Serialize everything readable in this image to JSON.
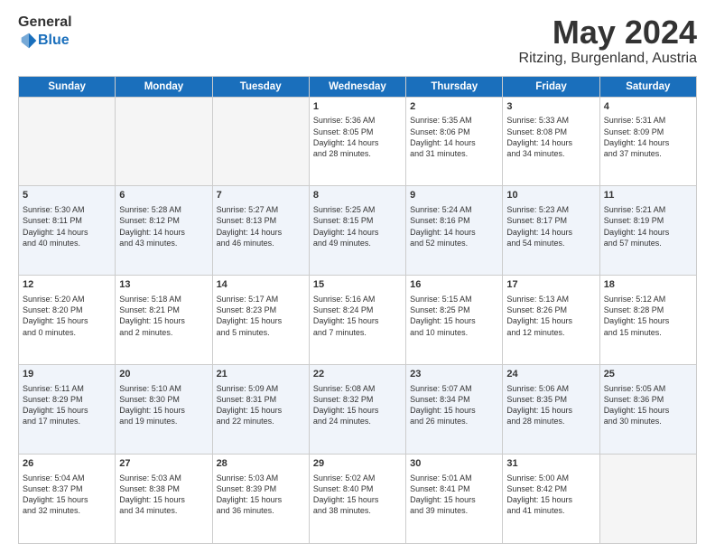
{
  "header": {
    "logo": {
      "general": "General",
      "blue": "Blue"
    },
    "title": "May 2024",
    "location": "Ritzing, Burgenland, Austria"
  },
  "days_of_week": [
    "Sunday",
    "Monday",
    "Tuesday",
    "Wednesday",
    "Thursday",
    "Friday",
    "Saturday"
  ],
  "weeks": [
    [
      {
        "day": "",
        "content": ""
      },
      {
        "day": "",
        "content": ""
      },
      {
        "day": "",
        "content": ""
      },
      {
        "day": "1",
        "content": "Sunrise: 5:36 AM\nSunset: 8:05 PM\nDaylight: 14 hours\nand 28 minutes."
      },
      {
        "day": "2",
        "content": "Sunrise: 5:35 AM\nSunset: 8:06 PM\nDaylight: 14 hours\nand 31 minutes."
      },
      {
        "day": "3",
        "content": "Sunrise: 5:33 AM\nSunset: 8:08 PM\nDaylight: 14 hours\nand 34 minutes."
      },
      {
        "day": "4",
        "content": "Sunrise: 5:31 AM\nSunset: 8:09 PM\nDaylight: 14 hours\nand 37 minutes."
      }
    ],
    [
      {
        "day": "5",
        "content": "Sunrise: 5:30 AM\nSunset: 8:11 PM\nDaylight: 14 hours\nand 40 minutes."
      },
      {
        "day": "6",
        "content": "Sunrise: 5:28 AM\nSunset: 8:12 PM\nDaylight: 14 hours\nand 43 minutes."
      },
      {
        "day": "7",
        "content": "Sunrise: 5:27 AM\nSunset: 8:13 PM\nDaylight: 14 hours\nand 46 minutes."
      },
      {
        "day": "8",
        "content": "Sunrise: 5:25 AM\nSunset: 8:15 PM\nDaylight: 14 hours\nand 49 minutes."
      },
      {
        "day": "9",
        "content": "Sunrise: 5:24 AM\nSunset: 8:16 PM\nDaylight: 14 hours\nand 52 minutes."
      },
      {
        "day": "10",
        "content": "Sunrise: 5:23 AM\nSunset: 8:17 PM\nDaylight: 14 hours\nand 54 minutes."
      },
      {
        "day": "11",
        "content": "Sunrise: 5:21 AM\nSunset: 8:19 PM\nDaylight: 14 hours\nand 57 minutes."
      }
    ],
    [
      {
        "day": "12",
        "content": "Sunrise: 5:20 AM\nSunset: 8:20 PM\nDaylight: 15 hours\nand 0 minutes."
      },
      {
        "day": "13",
        "content": "Sunrise: 5:18 AM\nSunset: 8:21 PM\nDaylight: 15 hours\nand 2 minutes."
      },
      {
        "day": "14",
        "content": "Sunrise: 5:17 AM\nSunset: 8:23 PM\nDaylight: 15 hours\nand 5 minutes."
      },
      {
        "day": "15",
        "content": "Sunrise: 5:16 AM\nSunset: 8:24 PM\nDaylight: 15 hours\nand 7 minutes."
      },
      {
        "day": "16",
        "content": "Sunrise: 5:15 AM\nSunset: 8:25 PM\nDaylight: 15 hours\nand 10 minutes."
      },
      {
        "day": "17",
        "content": "Sunrise: 5:13 AM\nSunset: 8:26 PM\nDaylight: 15 hours\nand 12 minutes."
      },
      {
        "day": "18",
        "content": "Sunrise: 5:12 AM\nSunset: 8:28 PM\nDaylight: 15 hours\nand 15 minutes."
      }
    ],
    [
      {
        "day": "19",
        "content": "Sunrise: 5:11 AM\nSunset: 8:29 PM\nDaylight: 15 hours\nand 17 minutes."
      },
      {
        "day": "20",
        "content": "Sunrise: 5:10 AM\nSunset: 8:30 PM\nDaylight: 15 hours\nand 19 minutes."
      },
      {
        "day": "21",
        "content": "Sunrise: 5:09 AM\nSunset: 8:31 PM\nDaylight: 15 hours\nand 22 minutes."
      },
      {
        "day": "22",
        "content": "Sunrise: 5:08 AM\nSunset: 8:32 PM\nDaylight: 15 hours\nand 24 minutes."
      },
      {
        "day": "23",
        "content": "Sunrise: 5:07 AM\nSunset: 8:34 PM\nDaylight: 15 hours\nand 26 minutes."
      },
      {
        "day": "24",
        "content": "Sunrise: 5:06 AM\nSunset: 8:35 PM\nDaylight: 15 hours\nand 28 minutes."
      },
      {
        "day": "25",
        "content": "Sunrise: 5:05 AM\nSunset: 8:36 PM\nDaylight: 15 hours\nand 30 minutes."
      }
    ],
    [
      {
        "day": "26",
        "content": "Sunrise: 5:04 AM\nSunset: 8:37 PM\nDaylight: 15 hours\nand 32 minutes."
      },
      {
        "day": "27",
        "content": "Sunrise: 5:03 AM\nSunset: 8:38 PM\nDaylight: 15 hours\nand 34 minutes."
      },
      {
        "day": "28",
        "content": "Sunrise: 5:03 AM\nSunset: 8:39 PM\nDaylight: 15 hours\nand 36 minutes."
      },
      {
        "day": "29",
        "content": "Sunrise: 5:02 AM\nSunset: 8:40 PM\nDaylight: 15 hours\nand 38 minutes."
      },
      {
        "day": "30",
        "content": "Sunrise: 5:01 AM\nSunset: 8:41 PM\nDaylight: 15 hours\nand 39 minutes."
      },
      {
        "day": "31",
        "content": "Sunrise: 5:00 AM\nSunset: 8:42 PM\nDaylight: 15 hours\nand 41 minutes."
      },
      {
        "day": "",
        "content": ""
      }
    ]
  ]
}
